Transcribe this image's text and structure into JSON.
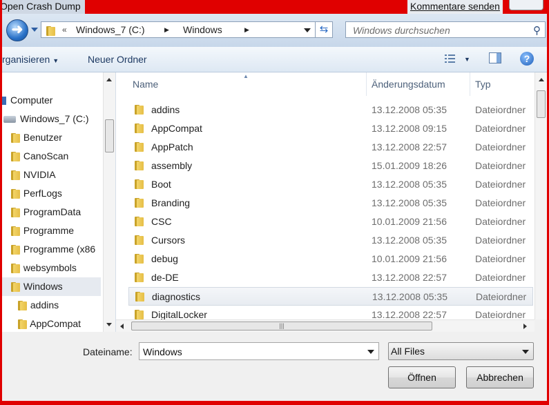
{
  "window": {
    "title": "Open Crash Dump",
    "feedback_link": "Kommentare senden"
  },
  "address": {
    "overflow": "«",
    "crumbs": [
      "Windows_7 (C:)",
      "Windows"
    ],
    "separator": "▶",
    "search_placeholder": "Windows durchsuchen"
  },
  "toolbar": {
    "organize": "rganisieren",
    "new_folder": "Neuer Ordner"
  },
  "nav": {
    "computer": "Computer",
    "drive": "Windows_7 (C:)",
    "folders": [
      "Benutzer",
      "CanoScan",
      "NVIDIA",
      "PerfLogs",
      "ProgramData",
      "Programme",
      "Programme (x86",
      "websymbols",
      "Windows"
    ],
    "subfolders": [
      "addins",
      "AppCompat"
    ],
    "selected": "Windows"
  },
  "columns": {
    "name": "Name",
    "date": "Änderungsdatum",
    "type": "Typ"
  },
  "files": [
    {
      "name": "addins",
      "date": "13.12.2008 05:35",
      "type": "Dateiordner"
    },
    {
      "name": "AppCompat",
      "date": "13.12.2008 09:15",
      "type": "Dateiordner"
    },
    {
      "name": "AppPatch",
      "date": "13.12.2008 22:57",
      "type": "Dateiordner"
    },
    {
      "name": "assembly",
      "date": "15.01.2009 18:26",
      "type": "Dateiordner"
    },
    {
      "name": "Boot",
      "date": "13.12.2008 05:35",
      "type": "Dateiordner"
    },
    {
      "name": "Branding",
      "date": "13.12.2008 05:35",
      "type": "Dateiordner"
    },
    {
      "name": "CSC",
      "date": "10.01.2009 21:56",
      "type": "Dateiordner"
    },
    {
      "name": "Cursors",
      "date": "13.12.2008 05:35",
      "type": "Dateiordner"
    },
    {
      "name": "debug",
      "date": "10.01.2009 21:56",
      "type": "Dateiordner"
    },
    {
      "name": "de-DE",
      "date": "13.12.2008 22:57",
      "type": "Dateiordner"
    },
    {
      "name": "diagnostics",
      "date": "13.12.2008 05:35",
      "type": "Dateiordner"
    },
    {
      "name": "DigitalLocker",
      "date": "13.12.2008 22:57",
      "type": "Dateiordner"
    }
  ],
  "hover_row": "diagnostics",
  "bottom": {
    "filename_label": "Dateiname:",
    "filename_value": "Windows",
    "filter": "All Files",
    "open_button": "Öffnen",
    "cancel_button": "Abbrechen"
  },
  "colors": {
    "highlight_border": "#e00000",
    "accent": "#2a72c8"
  }
}
